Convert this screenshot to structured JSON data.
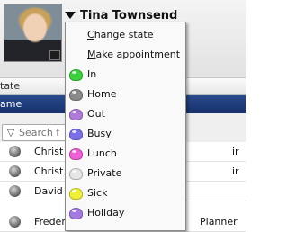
{
  "header": {
    "user_name": "Tina Townsend"
  },
  "list": {
    "column_header": "tate",
    "group_label": "ame",
    "search_placeholder": "Search f",
    "rows": [
      {
        "name": "Christ",
        "role": "",
        "right": "ir"
      },
      {
        "name": "Christ",
        "role": "",
        "right": "ir"
      },
      {
        "name": "David",
        "role": "",
        "right": ""
      },
      {
        "name": "Frederick Brown",
        "role": "Planner",
        "right": ""
      }
    ]
  },
  "menu": {
    "actions": [
      {
        "prefix": "",
        "accel": "C",
        "rest": "hange state"
      },
      {
        "prefix": "",
        "accel": "M",
        "rest": "ake appointment"
      }
    ],
    "states": [
      {
        "label": "In",
        "color": "#3ed13e",
        "icon": "status-in-icon"
      },
      {
        "label": "Home",
        "color": "#8a8a8a",
        "icon": "status-home-icon"
      },
      {
        "label": "Out",
        "color": "#b07ad8",
        "icon": "status-out-icon"
      },
      {
        "label": "Busy",
        "color": "#7b6fe8",
        "icon": "status-busy-icon"
      },
      {
        "label": "Lunch",
        "color": "#ee5ed4",
        "icon": "status-lunch-icon"
      },
      {
        "label": "Private",
        "color": "#e6e6e6",
        "icon": "status-private-icon"
      },
      {
        "label": "Sick",
        "color": "#f0f03a",
        "icon": "status-sick-icon"
      },
      {
        "label": "Holiday",
        "color": "#a27ae0",
        "icon": "status-holiday-icon"
      }
    ]
  }
}
